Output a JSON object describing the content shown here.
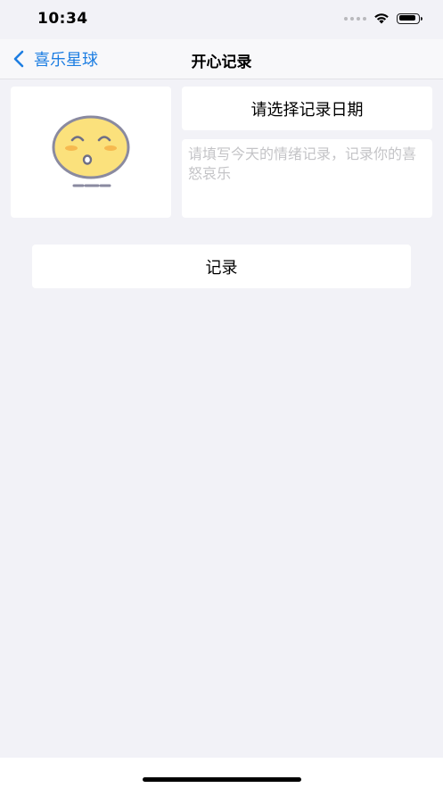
{
  "status_bar": {
    "time": "10:34",
    "battery_level": 0.9
  },
  "nav": {
    "back_label": "喜乐星球",
    "title": "开心记录"
  },
  "form": {
    "date_button_label": "请选择记录日期",
    "mood_placeholder": "请填写今天的情绪记录，记录你的喜怒哀乐",
    "mood_value": "",
    "submit_label": "记录"
  },
  "emoji": {
    "icon": "sleepy-face-icon",
    "face_color": "#fbe17c",
    "outline_color": "#8a8aa0",
    "cheek_color": "#f6b94f"
  },
  "colors": {
    "accent": "#1d7ee2",
    "background": "#f2f2f7"
  }
}
